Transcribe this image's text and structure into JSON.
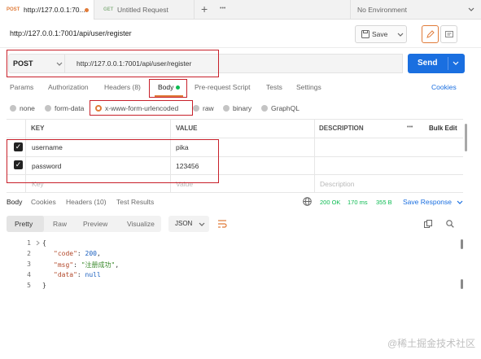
{
  "tabs": [
    {
      "method": "POST",
      "label": "http://127.0.0.1:70..."
    },
    {
      "method": "GET",
      "label": "Untitled Request"
    }
  ],
  "tabbar": {
    "add_label": "+",
    "more_label": "•••"
  },
  "environment": {
    "selected": "No Environment"
  },
  "request": {
    "title": "http://127.0.0.1:7001/api/user/register",
    "save_label": "Save",
    "method": "POST",
    "url": "http://127.0.0.1:7001/api/user/register",
    "send_label": "Send"
  },
  "request_tabs": [
    "Params",
    "Authorization",
    "Headers (8)",
    "Body",
    "Pre-request Script",
    "Tests",
    "Settings"
  ],
  "cookies_link": "Cookies",
  "body_types": [
    "none",
    "form-data",
    "x-www-form-urlencoded",
    "raw",
    "binary",
    "GraphQL"
  ],
  "table": {
    "headers": {
      "key": "KEY",
      "value": "VALUE",
      "description": "DESCRIPTION",
      "more": "•••",
      "bulk": "Bulk Edit"
    },
    "rows": [
      {
        "key": "username",
        "value": "pika"
      },
      {
        "key": "password",
        "value": "123456"
      }
    ],
    "placeholder": {
      "key": "Key",
      "value": "Value",
      "description": "Description"
    }
  },
  "response": {
    "tabs": [
      "Body",
      "Cookies",
      "Headers (10)",
      "Test Results"
    ],
    "status": "200 OK",
    "time": "170 ms",
    "size": "355 B",
    "save_label": "Save Response",
    "views": [
      "Pretty",
      "Raw",
      "Preview",
      "Visualize"
    ],
    "format": "JSON",
    "code": {
      "line_numbers": [
        "1",
        "2",
        "3",
        "4",
        "5"
      ],
      "open": "{",
      "code_key": "\"code\"",
      "code_val": "200",
      "msg_key": "\"msg\"",
      "msg_val": "\"注册成功\"",
      "data_key": "\"data\"",
      "data_val": "null",
      "close": "}",
      "colon": ": ",
      "comma": ","
    }
  },
  "watermark": "@稀土掘金技术社区",
  "colors": {
    "accent": "#1a6fe0",
    "post": "#e07b39",
    "success": "#0cbb52",
    "annotation": "#c8202a"
  }
}
